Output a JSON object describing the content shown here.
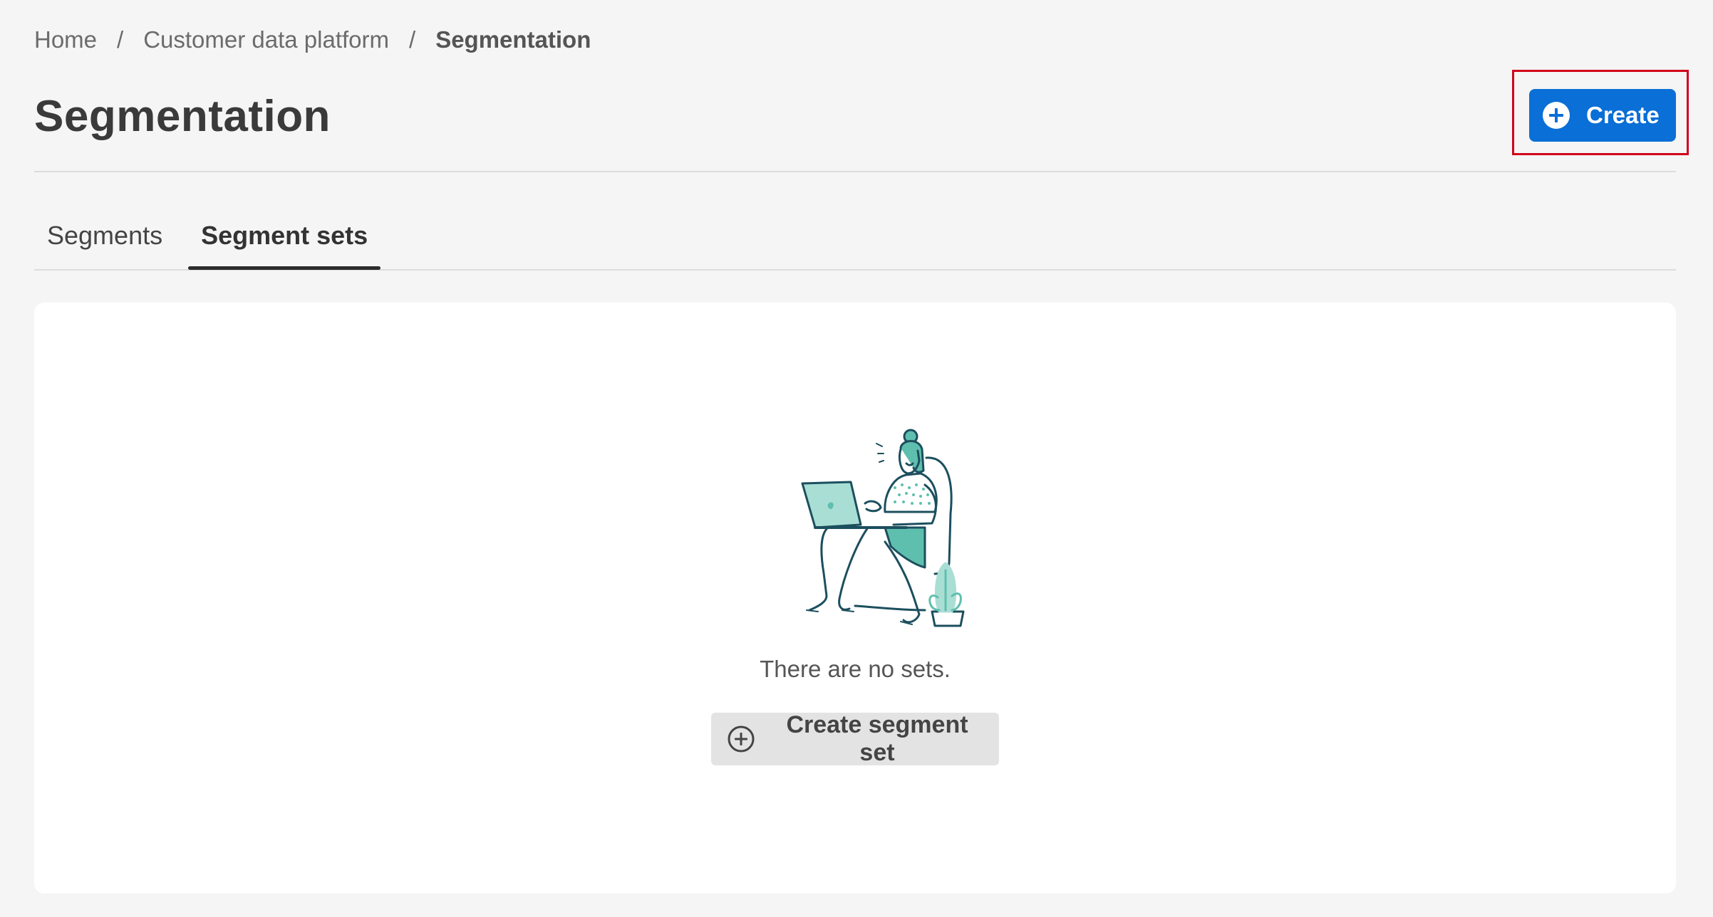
{
  "breadcrumb": {
    "items": [
      "Home",
      "Customer data platform",
      "Segmentation"
    ],
    "separator": "/"
  },
  "header": {
    "title": "Segmentation",
    "create_label": "Create"
  },
  "tabs": [
    {
      "label": "Segments",
      "active": false
    },
    {
      "label": "Segment sets",
      "active": true
    }
  ],
  "empty_state": {
    "message": "There are no sets.",
    "button_label": "Create segment set",
    "illustration": "woman-with-laptop-illustration"
  },
  "icons": {
    "create": "plus-circle-icon",
    "create_segment_set": "plus-circle-outline-icon"
  },
  "colors": {
    "primary": "#0a6fd6",
    "highlight": "#d0021b",
    "background": "#f5f5f5",
    "card": "#ffffff",
    "illustration_teal": "#5fbfae",
    "illustration_line": "#1c4f5e"
  }
}
